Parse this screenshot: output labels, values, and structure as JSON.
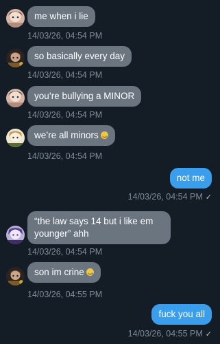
{
  "messages": [
    {
      "sender": "other",
      "text": "me when i lie",
      "time": "14/03/26, 04:54 PM"
    },
    {
      "sender": "other",
      "text": "so basically every day",
      "time": "14/03/26, 04:54 PM"
    },
    {
      "sender": "other",
      "text": "you’re bullying a MINOR",
      "time": "14/03/26, 04:54 PM"
    },
    {
      "sender": "other",
      "text": "we’re all minors",
      "emoji": "crying-laughing-emoji",
      "time": "14/03/26, 04:54 PM"
    },
    {
      "sender": "self",
      "text": "not me",
      "time": "14/03/26, 04:54 PM",
      "status": "✓"
    },
    {
      "sender": "other",
      "text": "“the law says 14 but i like em younger” ahh",
      "time": "14/03/26, 04:54 PM"
    },
    {
      "sender": "other",
      "text": "son im crine",
      "emoji": "crying-laughing-emoji",
      "time": "14/03/26, 04:55 PM"
    },
    {
      "sender": "self",
      "text": "fuck you all",
      "time": "14/03/26, 04:55 PM",
      "status": "✓"
    }
  ],
  "colors": {
    "background": "#141d26",
    "incoming_bubble": "#6a7580",
    "outgoing_bubble": "#3a9eec",
    "timestamp": "#7e8b98"
  }
}
